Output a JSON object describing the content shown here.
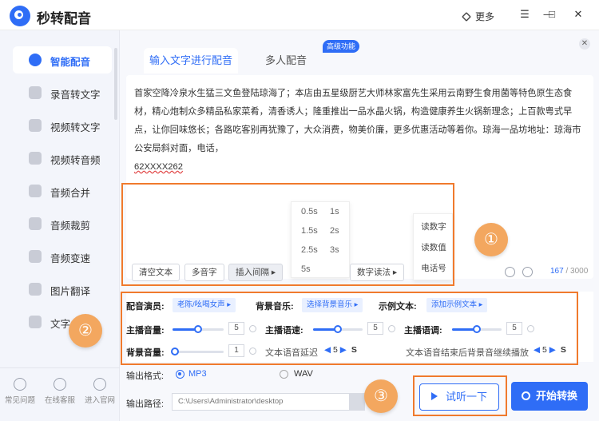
{
  "app": {
    "title": "秒转配音",
    "more_label": "更多"
  },
  "window_controls": {
    "menu": "☰",
    "minimize": "—",
    "maximize": "□",
    "close": "✕"
  },
  "sidebar": {
    "items": [
      {
        "label": "智能配音",
        "active": true
      },
      {
        "label": "录音转文字"
      },
      {
        "label": "视频转文字"
      },
      {
        "label": "视频转音频"
      },
      {
        "label": "音频合并"
      },
      {
        "label": "音频裁剪"
      },
      {
        "label": "音频变速"
      },
      {
        "label": "图片翻译"
      },
      {
        "label": "文字"
      }
    ],
    "bottom": [
      {
        "label": "常见问题"
      },
      {
        "label": "在线客服"
      },
      {
        "label": "进入官网"
      }
    ]
  },
  "tabs": {
    "text_dub": "输入文字进行配音",
    "multi_dub": "多人配音",
    "advanced_badge": "高级功能"
  },
  "editor": {
    "text": "首家空降冷泉水生猛三文鱼登陆琼海了；本店由五星级厨艺大师林家富先生采用云南野生食用菌等特色原生态食材，精心炮制众多精品私家菜肴，清香诱人；隆重推出一品水晶火锅，构造健康养生火锅新理念；上百款粤式早点，让你回味悠长；各路吃客别再犹豫了，大众消费，物美价廉，更多优惠活动等着你。琼海一品坊地址：琼海市公安局斜对面，电话，",
    "phone": "62XXXX262",
    "toolbar": {
      "clear": "清空文本",
      "polyphone": "多音字",
      "insert_pause": "插入间隔 ▸",
      "number_reading": "数字读法 ▸"
    },
    "pause_options": [
      "0.5s",
      "1s",
      "1.5s",
      "2s",
      "2.5s",
      "3s",
      "5s"
    ],
    "number_options": [
      "读数字",
      "读数值",
      "电话号"
    ],
    "count": "167",
    "count_total": " / 3000"
  },
  "markers": [
    "①",
    "②",
    "③"
  ],
  "settings": {
    "voice_label": "配音演员:",
    "voice_value": "老陈/吆喝女声 ▸",
    "bgm_label": "背景音乐:",
    "bgm_value": "选择背景音乐 ▸",
    "sample_label": "示例文本:",
    "sample_value": "添加示例文本 ▸",
    "main_volume_label": "主播音量:",
    "main_volume": "5",
    "main_speed_label": "主播语速:",
    "main_speed": "5",
    "main_pitch_label": "主播语调:",
    "main_pitch": "5",
    "bg_volume_label": "背景音量:",
    "bg_volume": "1",
    "delay_label": "文本语音延迟",
    "delay_value": "5",
    "bg_continue_label": "文本语音结束后背景音继续播放",
    "bg_continue_value": "5",
    "unit": "S",
    "levels": {
      "main_volume": 0.5,
      "main_speed": 0.5,
      "main_pitch": 0.5,
      "bg_volume": 0.05
    }
  },
  "output": {
    "format_label": "输出格式:",
    "mp3": "MP3",
    "wav": "WAV",
    "path_label": "输出路径:",
    "path_value": "C:\\Users\\Administrator\\desktop"
  },
  "actions": {
    "listen": "试听一下",
    "start": "开始转换"
  },
  "colors": {
    "accent": "#2f6df6",
    "highlight": "#f07a2d",
    "marker": "#f3a75f"
  }
}
